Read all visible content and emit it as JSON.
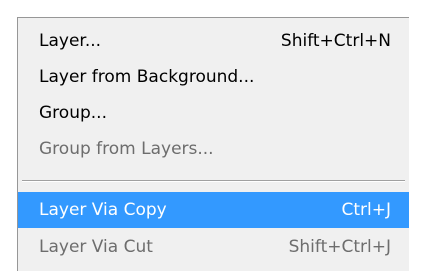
{
  "menu": {
    "items": [
      {
        "label": "Layer...",
        "shortcut": "Shift+Ctrl+N",
        "state": "enabled"
      },
      {
        "label": "Layer from Background...",
        "shortcut": "",
        "state": "enabled"
      },
      {
        "label": "Group...",
        "shortcut": "",
        "state": "enabled"
      },
      {
        "label": "Group from Layers...",
        "shortcut": "",
        "state": "disabled"
      },
      {
        "label": "Layer Via Copy",
        "shortcut": "Ctrl+J",
        "state": "highlighted"
      },
      {
        "label": "Layer Via Cut",
        "shortcut": "Shift+Ctrl+J",
        "state": "disabled"
      }
    ]
  },
  "colors": {
    "menu_background": "#f0f0f0",
    "highlight": "#3399ff",
    "highlight_text": "#ffffff",
    "disabled_text": "#6d6d6d",
    "text": "#000000"
  }
}
